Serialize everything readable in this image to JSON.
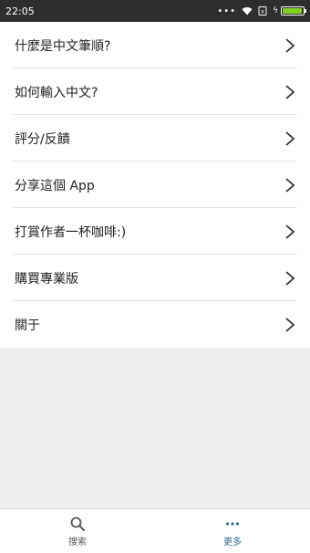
{
  "status_bar": {
    "time": "22:05",
    "signal_dots": "•••",
    "battery_level": 0.95,
    "battery_color": "#7ed321"
  },
  "menu": {
    "items": [
      {
        "label": "什麼是中文筆順?",
        "icon": "chevron-right-icon"
      },
      {
        "label": "如何輸入中文?",
        "icon": "chevron-right-icon"
      },
      {
        "label": "評分/反饋",
        "icon": "chevron-right-icon"
      },
      {
        "label": "分享這個 App",
        "icon": "chevron-right-icon"
      },
      {
        "label": "打賞作者一杯咖啡:)",
        "icon": "chevron-right-icon"
      },
      {
        "label": "購買專業版",
        "icon": "chevron-right-icon"
      },
      {
        "label": "關于",
        "icon": "chevron-right-icon"
      }
    ]
  },
  "tab_bar": {
    "tabs": [
      {
        "label": "搜索",
        "icon": "search-icon",
        "active": false
      },
      {
        "label": "更多",
        "icon": "more-icon",
        "active": true
      }
    ],
    "active_color": "#2e6e8e"
  }
}
